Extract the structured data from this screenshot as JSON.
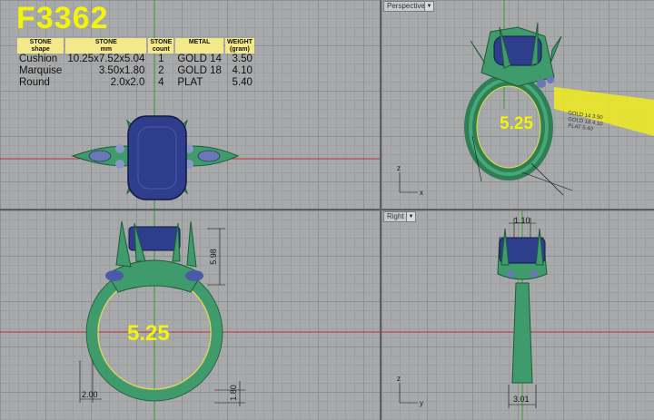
{
  "title": "F3362",
  "table": {
    "headers": [
      {
        "main": "STONE",
        "sub": "shape"
      },
      {
        "main": "STONE",
        "sub": "mm"
      },
      {
        "main": "STONE",
        "sub": "count"
      },
      {
        "main": "METAL",
        "sub": ""
      },
      {
        "main": "WEIGHT",
        "sub": "(gram)"
      }
    ],
    "rows": [
      [
        "Cushion",
        "10.25x7.52x5.04",
        "1",
        "GOLD 14",
        "3.50"
      ],
      [
        "Marquise",
        "3.50x1.80",
        "2",
        "GOLD 18",
        "4.10"
      ],
      [
        "Round",
        "2.0x2.0",
        "4",
        "PLAT",
        "5.40"
      ]
    ]
  },
  "viewports": {
    "perspective": {
      "label": "Perspective",
      "ring_size": "5.25"
    },
    "right": {
      "label": "Right"
    }
  },
  "dimensions": {
    "front_ring_size": "5.25",
    "front_height": "5.98",
    "front_shank_width": "2.00",
    "front_shank_thickness": "1.80",
    "right_top": "1.10",
    "right_bottom": "3.01"
  },
  "colors": {
    "metal": "#3f9a6c",
    "stone": "#2e3d8c",
    "highlight_text": "#f4f40a",
    "table_header": "#f3e98a",
    "axis_x": "#c03030",
    "axis_y": "#3a9a3a"
  }
}
